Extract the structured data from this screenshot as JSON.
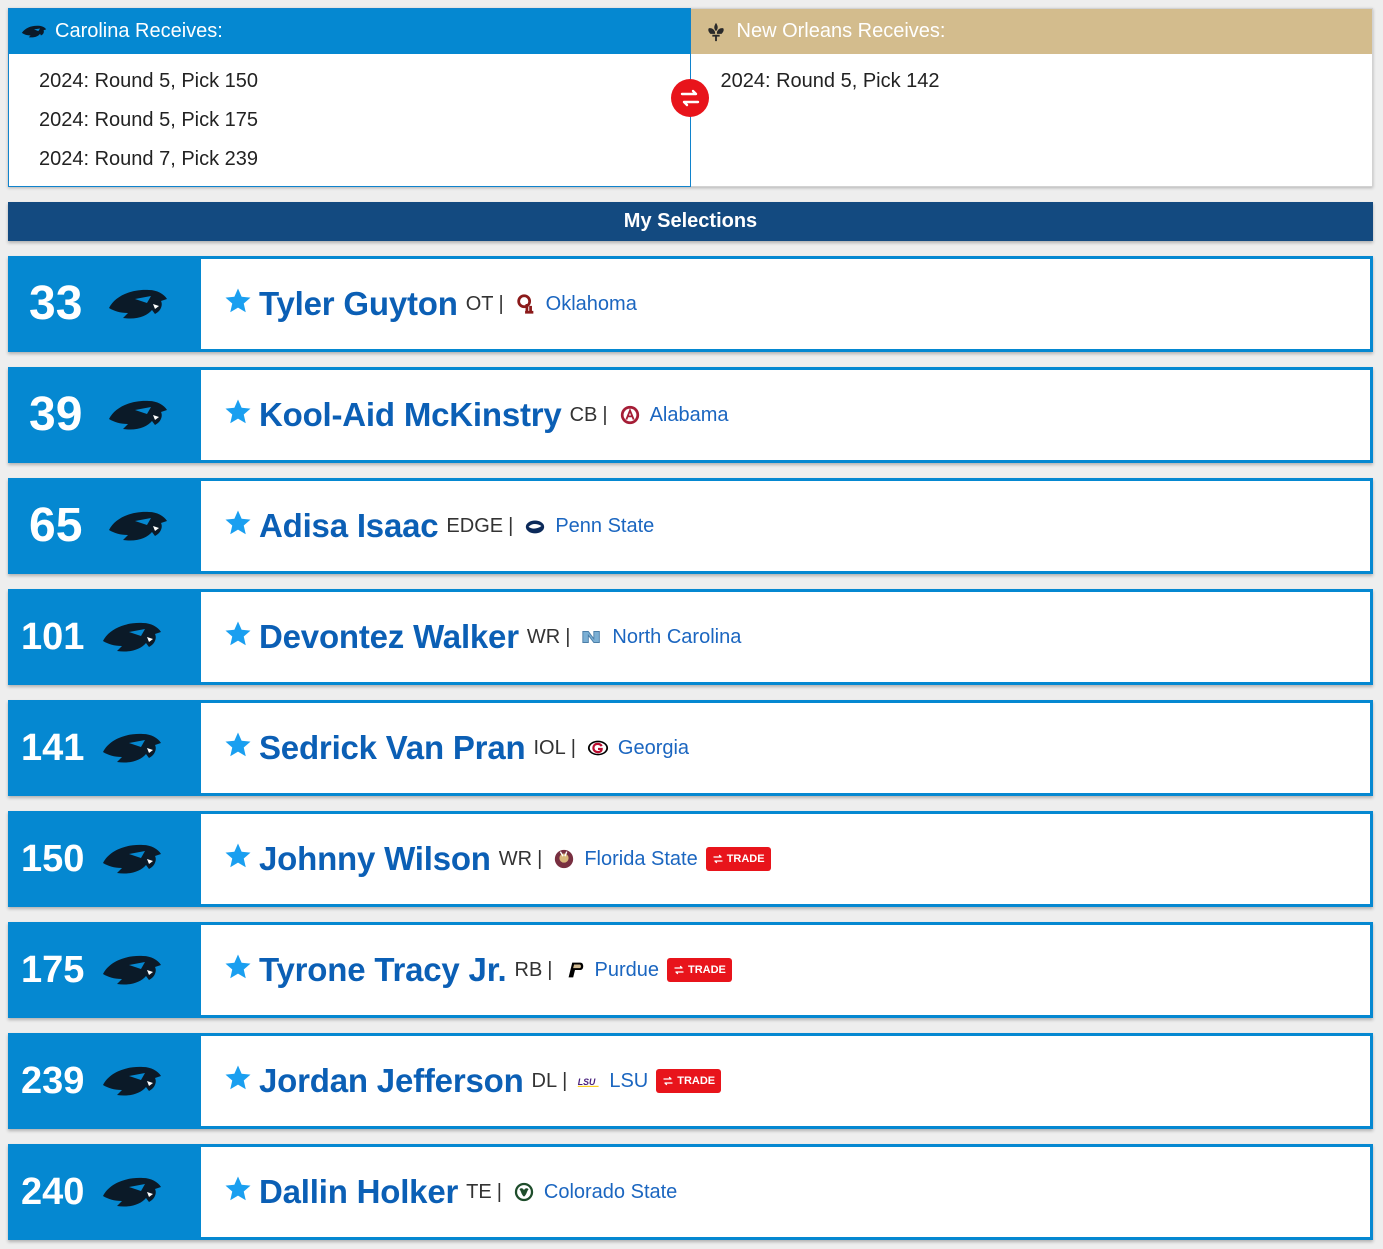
{
  "trade": {
    "left": {
      "header": "Carolina Receives:",
      "picks": [
        "2024: Round 5, Pick 150",
        "2024: Round 5, Pick 175",
        "2024: Round 7, Pick 239"
      ]
    },
    "right": {
      "header": "New Orleans Receives:",
      "picks": [
        "2024: Round 5, Pick 142"
      ]
    }
  },
  "section_title": "My Selections",
  "trade_badge_label": "TRADE",
  "colors": {
    "carolina_blue": "#0588d1",
    "saints_gold": "#d3bc8d",
    "section_navy": "#134a80",
    "player_name": "#0b5fb5",
    "star": "#1a9ff0",
    "trade_red": "#e8141b"
  },
  "selections": [
    {
      "pick": "33",
      "name": "Tyler Guyton",
      "pos": "OT",
      "sep": "|",
      "school": "Oklahoma",
      "school_icon": "oklahoma-logo-icon",
      "trade": false
    },
    {
      "pick": "39",
      "name": "Kool-Aid McKinstry",
      "pos": "CB",
      "sep": "|",
      "school": "Alabama",
      "school_icon": "alabama-logo-icon",
      "trade": false
    },
    {
      "pick": "65",
      "name": "Adisa Isaac",
      "pos": "EDGE",
      "sep": "|",
      "school": "Penn State",
      "school_icon": "penn-state-logo-icon",
      "trade": false
    },
    {
      "pick": "101",
      "name": "Devontez Walker",
      "pos": "WR",
      "sep": "|",
      "school": "North Carolina",
      "school_icon": "north-carolina-logo-icon",
      "trade": false
    },
    {
      "pick": "141",
      "name": "Sedrick Van Pran",
      "pos": "IOL",
      "sep": "|",
      "school": "Georgia",
      "school_icon": "georgia-logo-icon",
      "trade": false
    },
    {
      "pick": "150",
      "name": "Johnny Wilson",
      "pos": "WR",
      "sep": "|",
      "school": "Florida State",
      "school_icon": "florida-state-logo-icon",
      "trade": true
    },
    {
      "pick": "175",
      "name": "Tyrone Tracy Jr.",
      "pos": "RB",
      "sep": "|",
      "school": "Purdue",
      "school_icon": "purdue-logo-icon",
      "trade": true
    },
    {
      "pick": "239",
      "name": "Jordan Jefferson",
      "pos": "DL",
      "sep": "|",
      "school": "LSU",
      "school_icon": "lsu-logo-icon",
      "trade": true
    },
    {
      "pick": "240",
      "name": "Dallin Holker",
      "pos": "TE",
      "sep": "|",
      "school": "Colorado State",
      "school_icon": "colorado-state-logo-icon",
      "trade": false
    }
  ]
}
